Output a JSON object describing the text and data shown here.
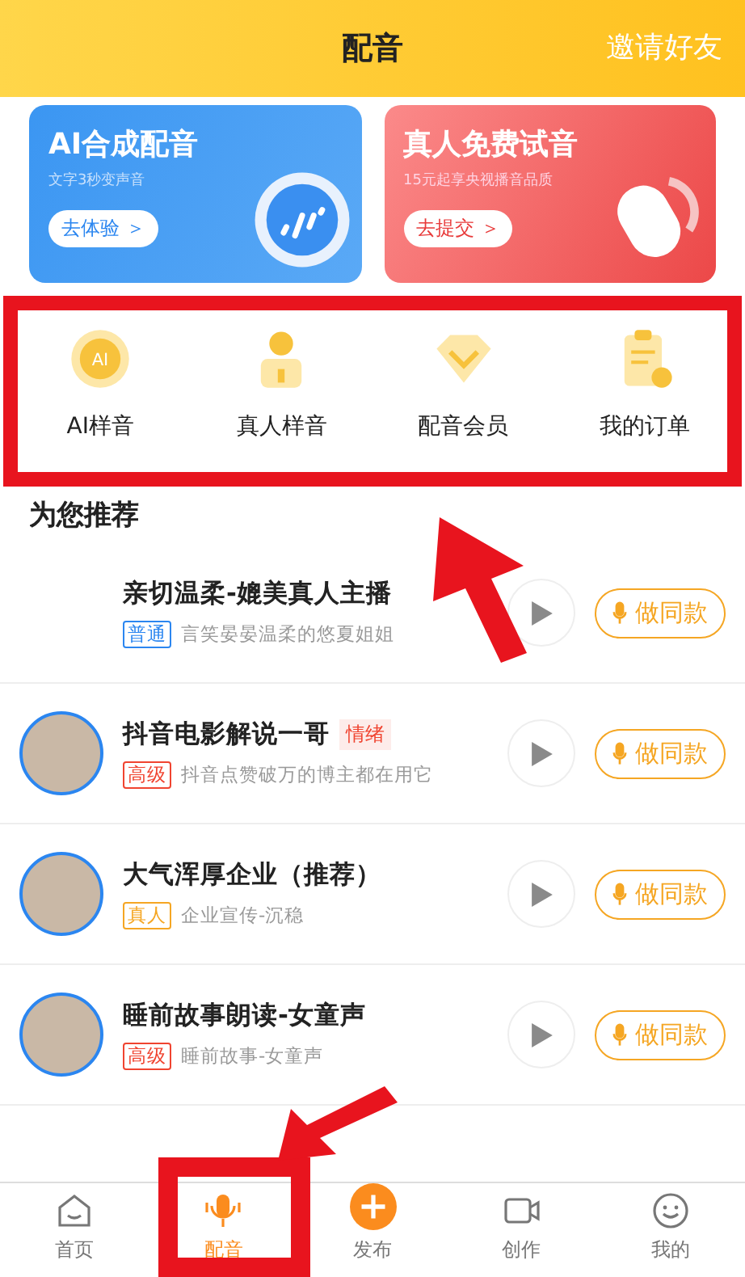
{
  "header": {
    "title": "配音",
    "action": "邀请好友"
  },
  "banners": [
    {
      "kind": "ai",
      "title": "AI合成配音",
      "subtitle": "文字3秒变声音",
      "button": "去体验 ＞"
    },
    {
      "kind": "human",
      "title": "真人免费试音",
      "subtitle": "15元起享央视播音品质",
      "button": "去提交 ＞"
    }
  ],
  "categories": [
    {
      "label": "AI样音",
      "icon_text": "AI"
    },
    {
      "label": "真人样音"
    },
    {
      "label": "配音会员"
    },
    {
      "label": "我的订单"
    }
  ],
  "section_title": "为您推荐",
  "voices": [
    {
      "avatar": false,
      "title": "亲切温柔-媲美真人主播",
      "badge": "普通",
      "color": "#2b86f0",
      "subtitle": "言笑晏晏温柔的悠夏姐姐",
      "button": "做同款"
    },
    {
      "avatar": true,
      "title": "抖音电影解说一哥",
      "tag": "情绪",
      "badge": "高级",
      "color": "#f04430",
      "subtitle": "抖音点赞破万的博主都在用它",
      "button": "做同款"
    },
    {
      "avatar": true,
      "title": "大气浑厚企业（推荐）",
      "badge": "真人",
      "color": "#f5a623",
      "subtitle": "企业宣传-沉稳",
      "button": "做同款"
    },
    {
      "avatar": true,
      "title": "睡前故事朗读-女童声",
      "badge": "高级",
      "color": "#f04430",
      "subtitle": "睡前故事-女童声",
      "button": "做同款"
    }
  ],
  "nav": [
    {
      "kind": "home",
      "label": "首页",
      "selected": false
    },
    {
      "kind": "mic",
      "label": "配音",
      "selected": true
    },
    {
      "kind": "plus",
      "label": "发布",
      "selected": false
    },
    {
      "kind": "video",
      "label": "创作",
      "selected": false
    },
    {
      "kind": "smile",
      "label": "我的",
      "selected": false
    }
  ]
}
